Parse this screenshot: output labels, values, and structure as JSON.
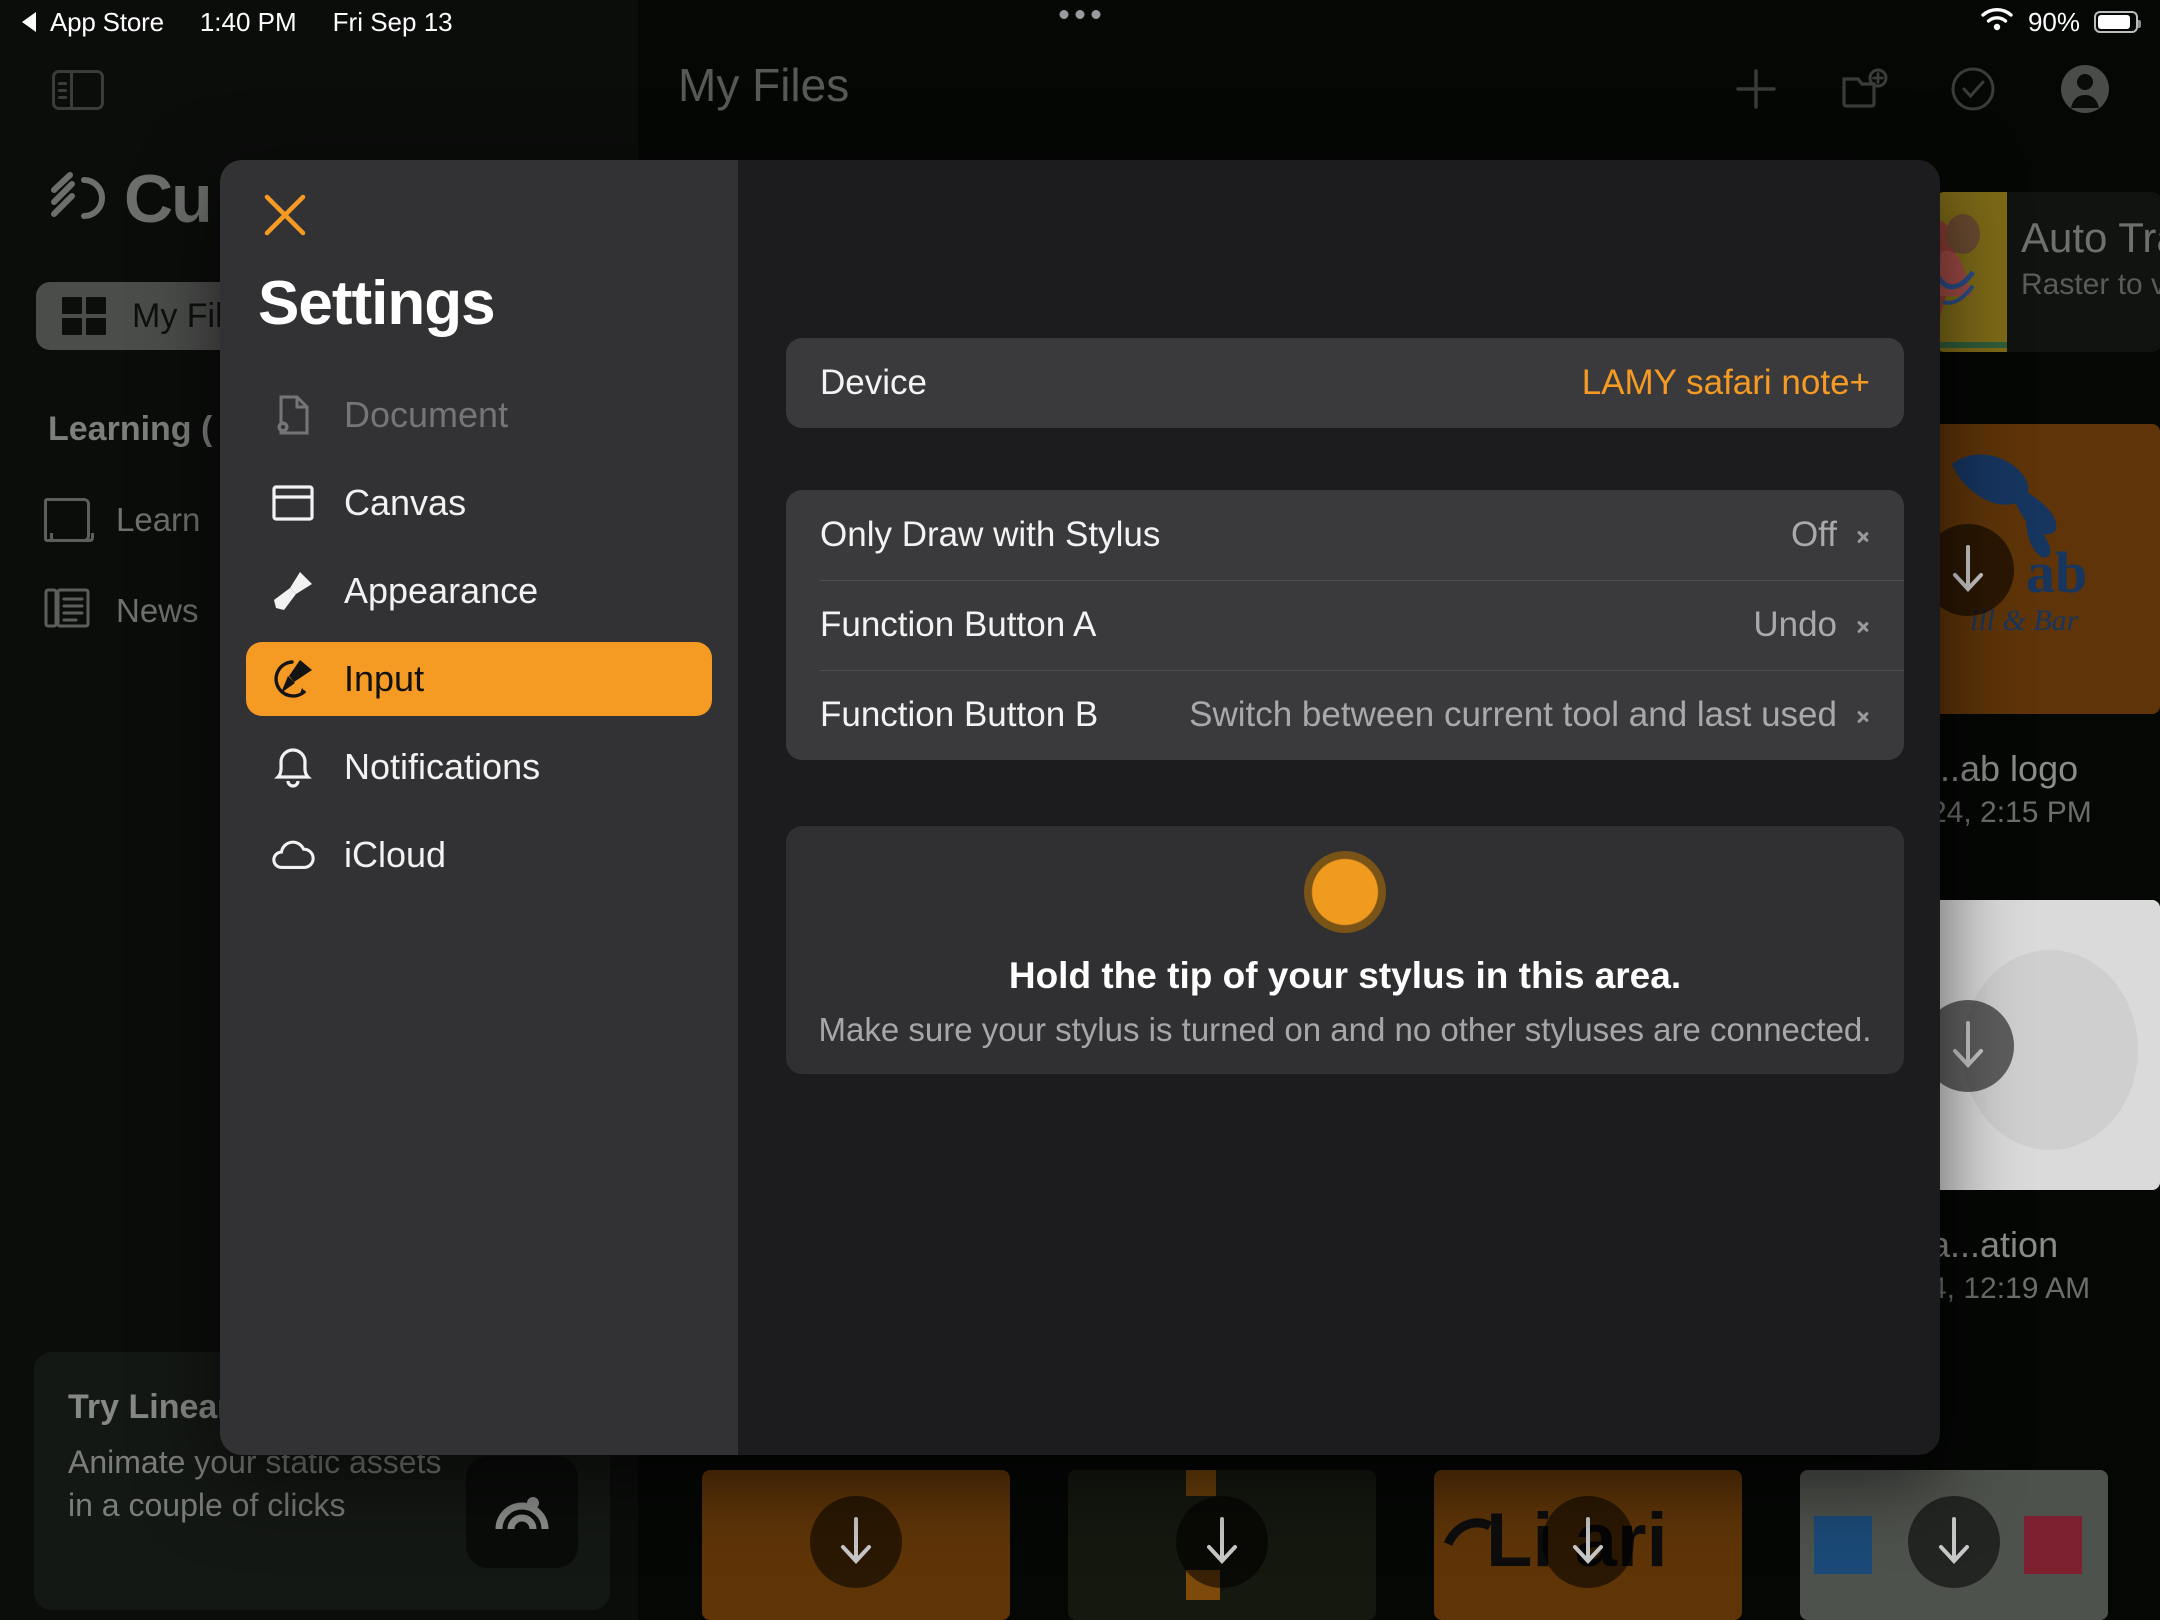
{
  "statusbar": {
    "back_label": "App Store",
    "time": "1:40 PM",
    "date": "Fri Sep 13",
    "battery_percent": "90%",
    "wifi_icon": "wifi-icon",
    "battery_icon": "battery-icon",
    "multitask_icon": "multitask-dots-icon"
  },
  "background_app": {
    "sidebar": {
      "toggle_icon": "sidebar-toggle-icon",
      "brand": "Cu",
      "brand_icon": "concepts-logo-icon",
      "my_files_label": "My Fil",
      "my_files_icon": "grid-icon",
      "section_header": "Learning (",
      "items": [
        {
          "label": "Learn",
          "icon": "book-icon"
        },
        {
          "label": "News",
          "icon": "newspaper-icon"
        }
      ],
      "promo": {
        "title": "Try Linear",
        "body": "Animate your static assets in a couple of clicks",
        "icon": "linearity-logo-icon"
      }
    },
    "header": {
      "title": "My Files",
      "actions": [
        {
          "name": "add-button",
          "icon": "plus-icon"
        },
        {
          "name": "new-folder-button",
          "icon": "folder-plus-icon"
        },
        {
          "name": "select-button",
          "icon": "check-circle-icon"
        },
        {
          "name": "account-button",
          "icon": "account-avatar-icon"
        }
      ]
    },
    "feature_card": {
      "title": "Auto Tra",
      "subtitle": "Raster to ve"
    },
    "files": [
      {
        "name": "...ab logo",
        "date": "24, 2:15 PM"
      },
      {
        "name": "a...ation",
        "date": "4, 12:19 AM"
      }
    ],
    "thumbnail_text": {
      "crab_logo_word": "ab",
      "crab_logo_tagline": "ill & Bar",
      "linearity_word": "Li ari"
    },
    "download_icon": "download-arrow-icon"
  },
  "modal": {
    "close_icon": "close-icon",
    "title": "Settings",
    "nav": [
      {
        "label": "Document",
        "icon": "document-gear-icon",
        "state": "disabled"
      },
      {
        "label": "Canvas",
        "icon": "canvas-icon",
        "state": "normal"
      },
      {
        "label": "Appearance",
        "icon": "brush-icon",
        "state": "normal"
      },
      {
        "label": "Input",
        "icon": "stylus-tip-icon",
        "state": "active"
      },
      {
        "label": "Notifications",
        "icon": "bell-icon",
        "state": "normal"
      },
      {
        "label": "iCloud",
        "icon": "cloud-icon",
        "state": "normal"
      }
    ],
    "device_row": {
      "label": "Device",
      "value": "LAMY safari note+"
    },
    "settings_rows": [
      {
        "label": "Only Draw with Stylus",
        "value": "Off",
        "chevron": "chevron-right-icon"
      },
      {
        "label": "Function Button A",
        "value": "Undo",
        "chevron": "chevron-right-icon"
      },
      {
        "label": "Function Button B",
        "value": "Switch between current tool and last used",
        "chevron": "chevron-right-icon"
      }
    ],
    "detect": {
      "indicator_icon": "stylus-detect-dot-icon",
      "title": "Hold the tip of your stylus in this area.",
      "subtitle": "Make sure your stylus is turned on and no other styluses are connected."
    }
  },
  "colors": {
    "accent": "#f59a23",
    "modal_sidebar": "#323234",
    "modal_content": "#1c1c1e",
    "card": "#3a3a3c",
    "card_muted": "#303032",
    "text_primary": "#f3f3f4",
    "text_secondary": "#a9a9ad",
    "text_disabled": "#757577"
  }
}
